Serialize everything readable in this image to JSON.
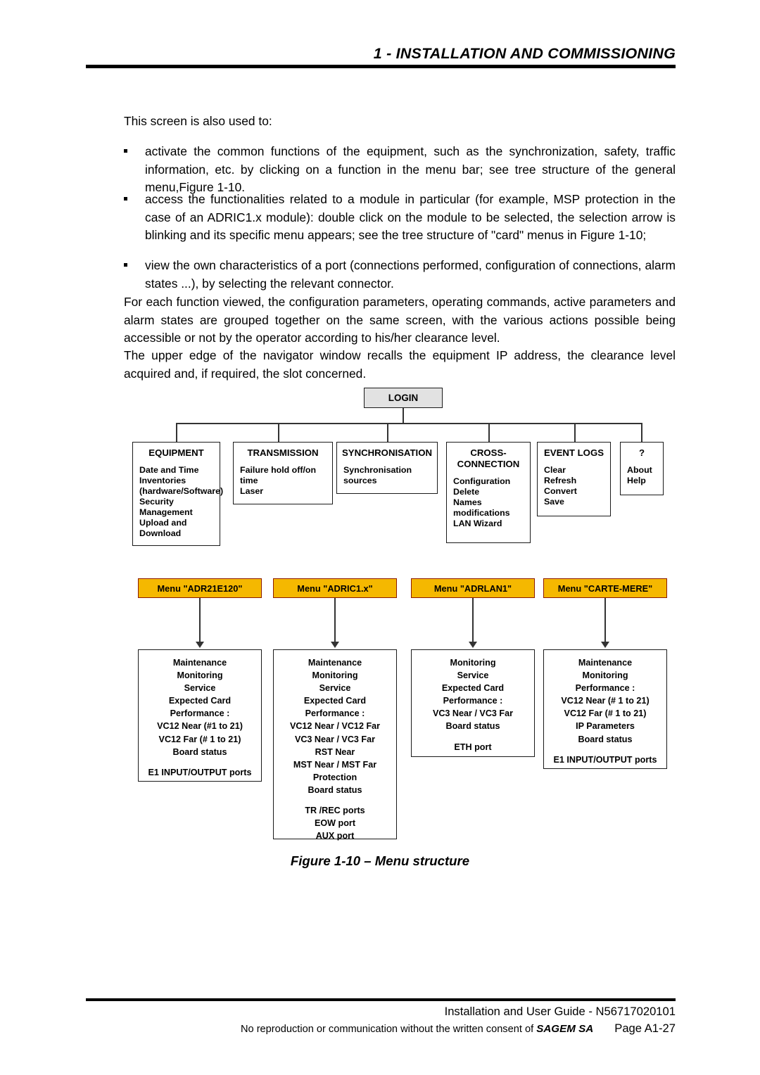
{
  "header": {
    "title": "1 - INSTALLATION AND COMMISSIONING"
  },
  "body": {
    "intro": "This screen is also used to:",
    "bullets": [
      "activate the common functions of the equipment, such as the synchronization, safety, traffic information, etc. by clicking on a function in the menu bar; see tree structure of the general menu,Figure 1-10.",
      "access the functionalities related to a module in particular (for example, MSP protection in the case of an ADRIC1.x module): double click on the module to be selected, the selection arrow is blinking and its specific menu appears; see the tree structure of \"card\" menus in Figure 1-10;",
      "view the own characteristics of a port (connections performed, configuration of connections, alarm states ...), by selecting the relevant connector."
    ],
    "para_1": "For each function viewed, the configuration parameters, operating commands, active parameters and alarm states are grouped together on the same screen, with the various actions possible being accessible or not by the operator according to his/her clearance level.",
    "para_2": "The upper edge of the navigator window recalls the equipment IP address, the clearance level acquired and, if required, the slot concerned."
  },
  "diagram": {
    "root": "LOGIN",
    "top_nodes": [
      {
        "title": "EQUIPMENT",
        "items": [
          "Date and Time",
          "Inventories\n(hardware/Software)",
          "Security",
          "Management",
          "Upload and\nDownload"
        ]
      },
      {
        "title": "TRANSMISSION",
        "items": [
          "Failure hold off/on\ntime",
          "Laser"
        ]
      },
      {
        "title": "SYNCHRONISATION",
        "items": [
          "Synchronisation\nsources"
        ]
      },
      {
        "title": "CROSS-\nCONNECTION",
        "items": [
          "Configuration",
          "Delete",
          "Names\nmodifications",
          "LAN Wizard"
        ]
      },
      {
        "title": "EVENT LOGS",
        "items": [
          "Clear",
          "Refresh",
          "Convert",
          "Save"
        ]
      },
      {
        "title": "?",
        "items": [
          "About",
          "Help"
        ]
      }
    ],
    "menu_labels": [
      "Menu \"ADR21E120\"",
      "Menu \"ADRIC1.x\"",
      "Menu \"ADRLAN1\"",
      "Menu \"CARTE-MERE\""
    ],
    "card_nodes": [
      {
        "lines": [
          "Maintenance",
          "Monitoring",
          "Service",
          "Expected Card",
          "Performance :",
          "VC12 Near (#1 to 21)",
          "VC12 Far (# 1 to 21)",
          "Board status",
          "",
          "E1 INPUT/OUTPUT ports"
        ]
      },
      {
        "lines": [
          "Maintenance",
          "Monitoring",
          "Service",
          "Expected Card",
          "Performance :",
          "VC12 Near / VC12 Far",
          "VC3 Near / VC3 Far",
          "RST Near",
          "MST Near / MST Far",
          "Protection",
          "Board status",
          "",
          "TR /REC ports",
          "EOW port",
          "AUX port"
        ]
      },
      {
        "lines": [
          "Monitoring",
          "Service",
          "Expected Card",
          "Performance :",
          "VC3 Near / VC3 Far",
          "Board status",
          "",
          "ETH port"
        ]
      },
      {
        "lines": [
          "Maintenance",
          "Monitoring",
          "Performance :",
          "VC12 Near (# 1 to 21)",
          "VC12 Far (# 1 to 21)",
          "IP Parameters",
          "Board status",
          "",
          "E1 INPUT/OUTPUT ports"
        ]
      }
    ],
    "caption": "Figure 1-10 – Menu structure"
  },
  "footer": {
    "guide": "Installation and User Guide - N56717020101",
    "notice": "No reproduction or communication without the written consent of",
    "company": "SAGEM SA",
    "page": "Page A1-27"
  },
  "colors": {
    "menu_fill": "#f5b800",
    "menu_border": "#8c1a00",
    "node_border": "#1a1a1a",
    "login_fill": "#e2e2e2"
  }
}
